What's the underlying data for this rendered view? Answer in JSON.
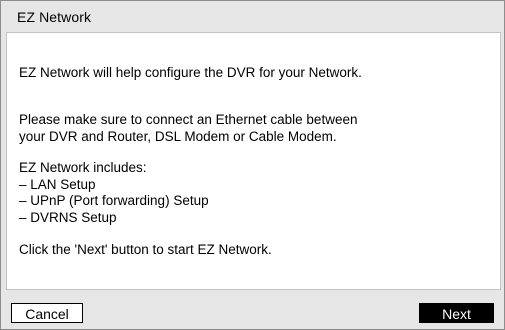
{
  "dialog": {
    "title": "EZ Network",
    "intro": "EZ Network will help configure the DVR for your Network.",
    "cable_notice": "Please make sure to connect an Ethernet cable between\nyour DVR and Router, DSL Modem or Cable Modem.",
    "includes_heading": "EZ Network includes:",
    "includes_items": [
      "– LAN Setup",
      "– UPnP (Port forwarding) Setup",
      "– DVRNS Setup"
    ],
    "click_instruction": "Click the 'Next' button to start EZ Network."
  },
  "buttons": {
    "cancel_label": "Cancel",
    "next_label": "Next"
  },
  "colors": {
    "frame": "#e6e6e6",
    "content_bg": "#ffffff",
    "next_bg": "#000000",
    "next_text": "#ffffff"
  }
}
